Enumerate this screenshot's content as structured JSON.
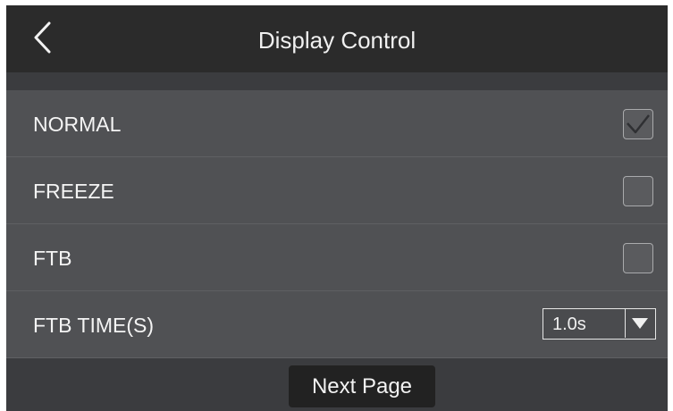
{
  "header": {
    "title": "Display Control",
    "back_icon": "chevron-left-icon"
  },
  "rows": [
    {
      "label": "NORMAL",
      "control": "checkbox",
      "checked": true
    },
    {
      "label": "FREEZE",
      "control": "checkbox",
      "checked": false
    },
    {
      "label": "FTB",
      "control": "checkbox",
      "checked": false
    },
    {
      "label": "FTB TIME(S)",
      "control": "dropdown",
      "value": "1.0s"
    }
  ],
  "footer": {
    "next_label": "Next Page"
  },
  "colors": {
    "header_bg": "#2b2b2b",
    "screen_bg": "#3b3c3f",
    "row_bg": "#505154",
    "button_bg": "#222222"
  }
}
